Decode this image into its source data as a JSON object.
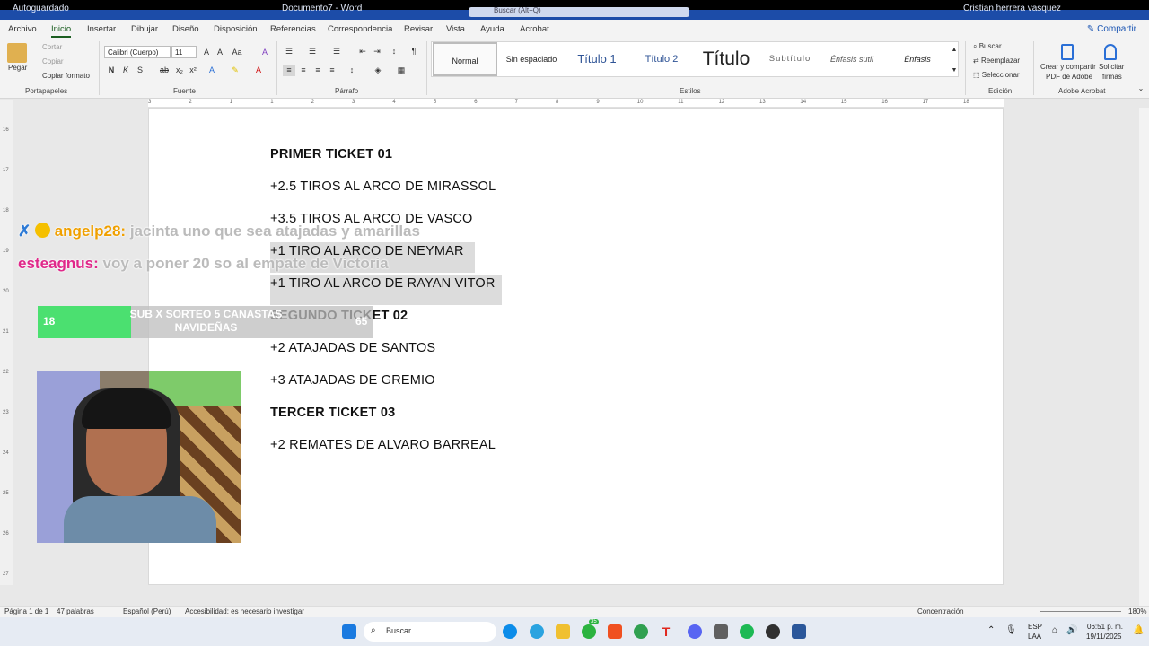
{
  "titlebar": {
    "autosave": "Autoguardado",
    "doc": "Documento7 - Word",
    "search_placeholder": "Buscar (Alt+Q)",
    "user": "Cristian herrera vasquez"
  },
  "menu": {
    "items": [
      "Archivo",
      "Inicio",
      "Insertar",
      "Dibujar",
      "Diseño",
      "Disposición",
      "Referencias",
      "Correspondencia",
      "Revisar",
      "Vista",
      "Ayuda",
      "Acrobat"
    ],
    "active": "Inicio",
    "share": "Compartir"
  },
  "ribbon": {
    "clipboard": {
      "paste": "Pegar",
      "cut": "Cortar",
      "copy": "Copiar",
      "format_painter": "Copiar formato",
      "label": "Portapapeles"
    },
    "font": {
      "family": "Calibri (Cuerpo)",
      "size": "11",
      "label": "Fuente"
    },
    "paragraph": {
      "label": "Párrafo"
    },
    "styles": {
      "label": "Estilos",
      "items": [
        "Normal",
        "Sin espaciado",
        "Título 1",
        "Título 2",
        "Título",
        "Subtítulo",
        "Énfasis sutil",
        "Énfasis"
      ]
    },
    "editing": {
      "find": "Buscar",
      "replace": "Reemplazar",
      "select": "Seleccionar",
      "label": "Edición"
    },
    "acrobat": {
      "create": "Crear y compartir",
      "create2": "PDF de Adobe",
      "sign": "Solicitar",
      "sign2": "firmas",
      "label": "Adobe Acrobat"
    }
  },
  "ruler": {
    "ticks": [
      "3",
      "2",
      "1",
      "1",
      "2",
      "3",
      "4",
      "5",
      "6",
      "7",
      "8",
      "9",
      "10",
      "11",
      "12",
      "13",
      "14",
      "15",
      "16",
      "17",
      "18"
    ],
    "vticks": [
      "16",
      "17",
      "18",
      "19",
      "20",
      "21",
      "22",
      "23",
      "24",
      "25",
      "26",
      "27"
    ]
  },
  "document": {
    "lines": [
      "PRIMER TICKET 01",
      "+2.5 TIROS AL ARCO DE MIRASSOL",
      "+3.5 TIROS AL ARCO DE VASCO",
      "+1 TIRO AL ARCO DE NEYMAR",
      "+1 TIRO AL ARCO DE RAYAN VITOR",
      "SEGUNDO TICKET 02",
      "+2 ATAJADAS DE SANTOS",
      "+3 ATAJADAS DE GREMIO",
      "TERCER TICKET 03",
      "+2 REMATES DE ALVARO BARREAL"
    ]
  },
  "overlay": {
    "chat": [
      {
        "user": "angelp28:",
        "message": "jacinta uno que sea atajadas y amarillas",
        "color": "#f0a000"
      },
      {
        "user": "esteagnus:",
        "message": "voy a poner 20 so al empate de Victoria",
        "color": "#e0288a"
      }
    ],
    "goal": {
      "current": "18",
      "text": "SUB X SORTEO 5 CANASTAS NAVIDEÑAS",
      "target": "65",
      "progress": 0.277
    }
  },
  "statusbar": {
    "page": "Página 1 de 1",
    "words": "47 palabras",
    "lang": "Español (Perú)",
    "access": "Accesibilidad: es necesario investigar",
    "focus": "Concentración",
    "zoom": "180%"
  },
  "taskbar": {
    "search": "Buscar",
    "lang": "ESP",
    "lang2": "LAA",
    "time": "06:51 p. m.",
    "date": "19/11/2025",
    "badge": "35"
  }
}
